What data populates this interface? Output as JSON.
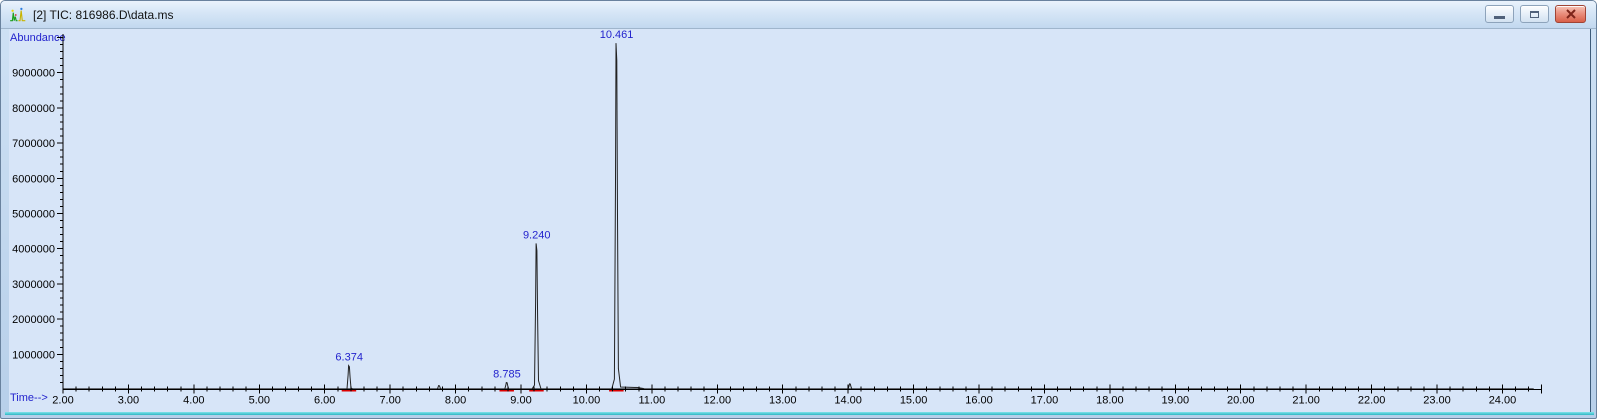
{
  "window": {
    "title": "[2] TIC: 816986.D\\data.ms",
    "icon": "chromatogram-icon",
    "buttons": {
      "minimize": "minimize",
      "maximize": "maximize",
      "close": "close"
    }
  },
  "chart_data": {
    "type": "line",
    "title": "TIC: 816986.D\\data.ms",
    "xlabel": "Time-->",
    "ylabel": "Abundance",
    "x_axis": {
      "min": 2.0,
      "max": 24.6,
      "major_tick_interval": 1.0,
      "minor_tick_interval": 0.2,
      "tick_labels": [
        "2.00",
        "3.00",
        "4.00",
        "5.00",
        "6.00",
        "7.00",
        "8.00",
        "9.00",
        "10.00",
        "11.00",
        "12.00",
        "13.00",
        "14.00",
        "15.00",
        "16.00",
        "17.00",
        "18.00",
        "19.00",
        "20.00",
        "21.00",
        "22.00",
        "23.00",
        "24.00"
      ]
    },
    "y_axis": {
      "min": 0,
      "max": 10100000,
      "major_tick_interval": 1000000,
      "minor_tick_interval": 200000,
      "tick_labels": [
        "1000000",
        "2000000",
        "3000000",
        "4000000",
        "5000000",
        "6000000",
        "7000000",
        "8000000",
        "9000000"
      ]
    },
    "peaks": [
      {
        "rt": 6.374,
        "abundance": 680000,
        "label": "6.374",
        "integrated": true
      },
      {
        "rt": 7.75,
        "abundance": 110000,
        "label": "",
        "integrated": false
      },
      {
        "rt": 8.785,
        "abundance": 200000,
        "label": "8.785",
        "integrated": true
      },
      {
        "rt": 9.24,
        "abundance": 4150000,
        "label": "9.240",
        "integrated": true
      },
      {
        "rt": 10.461,
        "abundance": 9840000,
        "label": "10.461",
        "integrated": true,
        "tail_to": 10.9
      },
      {
        "rt": 14.03,
        "abundance": 160000,
        "label": "",
        "integrated": false
      }
    ],
    "grid": false,
    "legend": "none",
    "colors": {
      "trace": "#222222",
      "peak_label": "#2323cd",
      "axis_label": "#2323cd",
      "tick_label": "#000000",
      "integration_mark": "#dd0000",
      "plot_bg": "#d7e5f8",
      "axis": "#000000"
    }
  }
}
